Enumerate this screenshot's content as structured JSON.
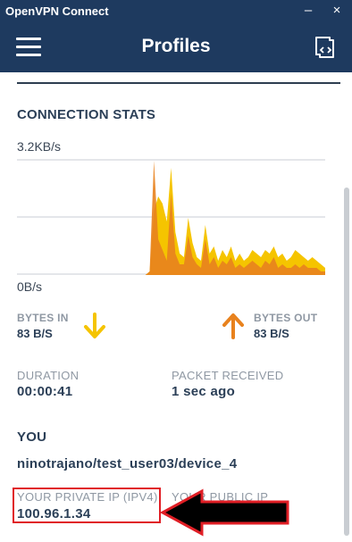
{
  "window": {
    "title": "OpenVPN Connect",
    "minimize_glyph": "–",
    "close_glyph": "×"
  },
  "header": {
    "title": "Profiles",
    "menu_icon": "hamburger-menu-icon",
    "import_icon": "import-profile-icon"
  },
  "connection_stats": {
    "title": "CONNECTION STATS",
    "y_max_label": "3.2KB/s",
    "y_min_label": "0B/s"
  },
  "chart_data": {
    "type": "area",
    "ylim": [
      0,
      3.2
    ],
    "yunit": "KB/s",
    "series": [
      {
        "color": "#f5c400",
        "values": [
          0,
          0,
          0,
          0,
          0,
          0,
          0,
          0,
          0,
          0,
          0,
          0,
          0,
          0,
          0,
          0,
          0,
          0,
          0,
          0,
          0,
          0,
          0,
          0,
          0,
          0,
          0,
          0,
          0,
          0,
          0,
          0.1,
          1.8,
          2.2,
          2.0,
          1.5,
          3.0,
          1.2,
          0.6,
          0.5,
          1.6,
          0.9,
          0.5,
          0.4,
          1.4,
          0.6,
          0.8,
          0.4,
          0.7,
          0.5,
          0.8,
          0.4,
          0.6,
          0.4,
          0.5,
          0.7,
          0.6,
          0.5,
          0.7,
          0.6,
          0.8,
          0.5,
          0.6,
          0.4,
          0.5,
          0.7,
          0.6,
          0.5,
          0.4,
          0.5,
          0.4,
          0.3,
          0.2
        ]
      },
      {
        "color": "#e8821e",
        "values": [
          0,
          0,
          0,
          0,
          0,
          0,
          0,
          0,
          0,
          0,
          0,
          0,
          0,
          0,
          0,
          0,
          0,
          0,
          0,
          0,
          0,
          0,
          0,
          0,
          0,
          0,
          0,
          0,
          0,
          0,
          0,
          0.1,
          3.2,
          1.0,
          0.7,
          0.4,
          2.3,
          0.6,
          0.3,
          0.3,
          1.1,
          0.5,
          0.3,
          0.2,
          1.0,
          0.3,
          0.5,
          0.2,
          0.4,
          0.3,
          0.5,
          0.2,
          0.3,
          0.2,
          0.3,
          0.4,
          0.3,
          0.2,
          0.4,
          0.3,
          0.5,
          0.2,
          0.3,
          0.2,
          0.2,
          0.3,
          0.2,
          0.3,
          0.2,
          0.2,
          0.2,
          0.1,
          0.1
        ]
      }
    ],
    "grid": true
  },
  "bytes": {
    "in_label": "BYTES IN",
    "in_value": "83 B/S",
    "in_color": "#f5c400",
    "out_label": "BYTES OUT",
    "out_value": "83 B/S",
    "out_color": "#e8821e"
  },
  "session": {
    "duration_label": "DURATION",
    "duration_value": "00:00:41",
    "packet_label": "PACKET RECEIVED",
    "packet_value": "1 sec ago"
  },
  "you": {
    "title": "YOU",
    "profile": "ninotrajano/test_user03/device_4",
    "private_ip_label": "YOUR PRIVATE IP (IPV4)",
    "private_ip_value": "100.96.1.34",
    "public_ip_label": "YOUR PUBLIC IP"
  },
  "annotation": {
    "highlight_color": "#e01e25",
    "arrow_fill": "#000000"
  }
}
